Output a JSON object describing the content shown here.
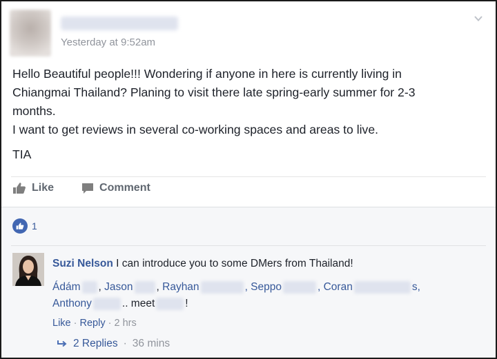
{
  "post": {
    "timestamp": "Yesterday at 9:52am",
    "lines": [
      "Hello Beautiful people!!! Wondering if anyone in here is currently living in",
      "Chiangmai Thailand? Planing to visit there late spring-early summer for 2-3",
      "months.",
      "I want to get reviews in several co-working spaces and areas to live."
    ],
    "closing": "TIA",
    "actions": {
      "like": "Like",
      "comment": "Comment"
    },
    "icons": {
      "menu": "chevron-down-icon",
      "like": "thumbs-up-icon",
      "comment": "speech-bubble-icon"
    }
  },
  "reactions": {
    "count": "1",
    "icon": "like-reaction-icon",
    "color": "#4267b2"
  },
  "comment": {
    "author": "Suzi Nelson",
    "text": "I can introduce you to some DMers from Thailand!",
    "mentions": {
      "m1": "Ádám",
      "m2": "Jason",
      "m3": "Rayhan",
      "m4": ", Seppo",
      "m5": ", Coran",
      "m6": "s,",
      "m7": "Anthony",
      "m8": ".. meet",
      "m9": "!"
    },
    "meta": {
      "like": "Like",
      "sep1": "·",
      "reply": "Reply",
      "sep2": "·",
      "time": "2 hrs"
    }
  },
  "replies": {
    "label": "2 Replies",
    "sep": "·",
    "time": "36 mins"
  },
  "colors": {
    "link": "#365899",
    "muted": "#90949c",
    "text": "#1d2129"
  }
}
